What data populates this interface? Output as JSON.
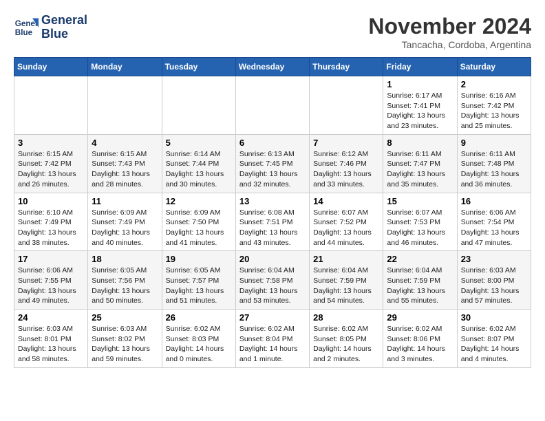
{
  "header": {
    "logo_line1": "General",
    "logo_line2": "Blue",
    "month": "November 2024",
    "location": "Tancacha, Cordoba, Argentina"
  },
  "weekdays": [
    "Sunday",
    "Monday",
    "Tuesday",
    "Wednesday",
    "Thursday",
    "Friday",
    "Saturday"
  ],
  "weeks": [
    [
      {
        "day": "",
        "info": ""
      },
      {
        "day": "",
        "info": ""
      },
      {
        "day": "",
        "info": ""
      },
      {
        "day": "",
        "info": ""
      },
      {
        "day": "",
        "info": ""
      },
      {
        "day": "1",
        "info": "Sunrise: 6:17 AM\nSunset: 7:41 PM\nDaylight: 13 hours\nand 23 minutes."
      },
      {
        "day": "2",
        "info": "Sunrise: 6:16 AM\nSunset: 7:42 PM\nDaylight: 13 hours\nand 25 minutes."
      }
    ],
    [
      {
        "day": "3",
        "info": "Sunrise: 6:15 AM\nSunset: 7:42 PM\nDaylight: 13 hours\nand 26 minutes."
      },
      {
        "day": "4",
        "info": "Sunrise: 6:15 AM\nSunset: 7:43 PM\nDaylight: 13 hours\nand 28 minutes."
      },
      {
        "day": "5",
        "info": "Sunrise: 6:14 AM\nSunset: 7:44 PM\nDaylight: 13 hours\nand 30 minutes."
      },
      {
        "day": "6",
        "info": "Sunrise: 6:13 AM\nSunset: 7:45 PM\nDaylight: 13 hours\nand 32 minutes."
      },
      {
        "day": "7",
        "info": "Sunrise: 6:12 AM\nSunset: 7:46 PM\nDaylight: 13 hours\nand 33 minutes."
      },
      {
        "day": "8",
        "info": "Sunrise: 6:11 AM\nSunset: 7:47 PM\nDaylight: 13 hours\nand 35 minutes."
      },
      {
        "day": "9",
        "info": "Sunrise: 6:11 AM\nSunset: 7:48 PM\nDaylight: 13 hours\nand 36 minutes."
      }
    ],
    [
      {
        "day": "10",
        "info": "Sunrise: 6:10 AM\nSunset: 7:49 PM\nDaylight: 13 hours\nand 38 minutes."
      },
      {
        "day": "11",
        "info": "Sunrise: 6:09 AM\nSunset: 7:49 PM\nDaylight: 13 hours\nand 40 minutes."
      },
      {
        "day": "12",
        "info": "Sunrise: 6:09 AM\nSunset: 7:50 PM\nDaylight: 13 hours\nand 41 minutes."
      },
      {
        "day": "13",
        "info": "Sunrise: 6:08 AM\nSunset: 7:51 PM\nDaylight: 13 hours\nand 43 minutes."
      },
      {
        "day": "14",
        "info": "Sunrise: 6:07 AM\nSunset: 7:52 PM\nDaylight: 13 hours\nand 44 minutes."
      },
      {
        "day": "15",
        "info": "Sunrise: 6:07 AM\nSunset: 7:53 PM\nDaylight: 13 hours\nand 46 minutes."
      },
      {
        "day": "16",
        "info": "Sunrise: 6:06 AM\nSunset: 7:54 PM\nDaylight: 13 hours\nand 47 minutes."
      }
    ],
    [
      {
        "day": "17",
        "info": "Sunrise: 6:06 AM\nSunset: 7:55 PM\nDaylight: 13 hours\nand 49 minutes."
      },
      {
        "day": "18",
        "info": "Sunrise: 6:05 AM\nSunset: 7:56 PM\nDaylight: 13 hours\nand 50 minutes."
      },
      {
        "day": "19",
        "info": "Sunrise: 6:05 AM\nSunset: 7:57 PM\nDaylight: 13 hours\nand 51 minutes."
      },
      {
        "day": "20",
        "info": "Sunrise: 6:04 AM\nSunset: 7:58 PM\nDaylight: 13 hours\nand 53 minutes."
      },
      {
        "day": "21",
        "info": "Sunrise: 6:04 AM\nSunset: 7:59 PM\nDaylight: 13 hours\nand 54 minutes."
      },
      {
        "day": "22",
        "info": "Sunrise: 6:04 AM\nSunset: 7:59 PM\nDaylight: 13 hours\nand 55 minutes."
      },
      {
        "day": "23",
        "info": "Sunrise: 6:03 AM\nSunset: 8:00 PM\nDaylight: 13 hours\nand 57 minutes."
      }
    ],
    [
      {
        "day": "24",
        "info": "Sunrise: 6:03 AM\nSunset: 8:01 PM\nDaylight: 13 hours\nand 58 minutes."
      },
      {
        "day": "25",
        "info": "Sunrise: 6:03 AM\nSunset: 8:02 PM\nDaylight: 13 hours\nand 59 minutes."
      },
      {
        "day": "26",
        "info": "Sunrise: 6:02 AM\nSunset: 8:03 PM\nDaylight: 14 hours\nand 0 minutes."
      },
      {
        "day": "27",
        "info": "Sunrise: 6:02 AM\nSunset: 8:04 PM\nDaylight: 14 hours\nand 1 minute."
      },
      {
        "day": "28",
        "info": "Sunrise: 6:02 AM\nSunset: 8:05 PM\nDaylight: 14 hours\nand 2 minutes."
      },
      {
        "day": "29",
        "info": "Sunrise: 6:02 AM\nSunset: 8:06 PM\nDaylight: 14 hours\nand 3 minutes."
      },
      {
        "day": "30",
        "info": "Sunrise: 6:02 AM\nSunset: 8:07 PM\nDaylight: 14 hours\nand 4 minutes."
      }
    ]
  ]
}
